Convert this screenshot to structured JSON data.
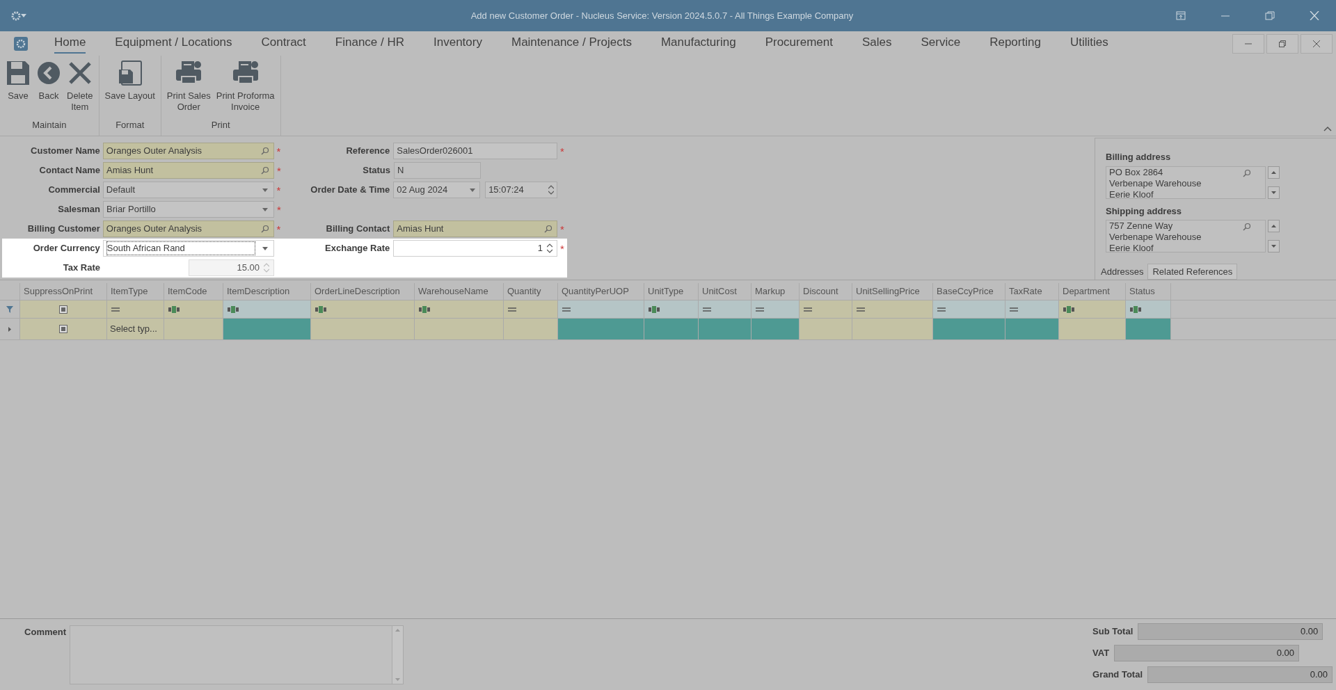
{
  "title_bar": {
    "title": "Add new Customer Order - Nucleus Service: Version 2024.5.0.7 - All Things Example Company"
  },
  "menu_tabs": [
    {
      "label": "Home",
      "selected": true
    },
    {
      "label": "Equipment / Locations",
      "selected": false
    },
    {
      "label": "Contract",
      "selected": false
    },
    {
      "label": "Finance / HR",
      "selected": false
    },
    {
      "label": "Inventory",
      "selected": false
    },
    {
      "label": "Maintenance / Projects",
      "selected": false
    },
    {
      "label": "Manufacturing",
      "selected": false
    },
    {
      "label": "Procurement",
      "selected": false
    },
    {
      "label": "Sales",
      "selected": false
    },
    {
      "label": "Service",
      "selected": false
    },
    {
      "label": "Reporting",
      "selected": false
    },
    {
      "label": "Utilities",
      "selected": false
    }
  ],
  "ribbon_groups": [
    {
      "label": "Maintain",
      "buttons": [
        {
          "label": "Save"
        },
        {
          "label": "Back"
        },
        {
          "label": "Delete\nItem"
        }
      ]
    },
    {
      "label": "Format",
      "buttons": [
        {
          "label": "Save Layout"
        }
      ]
    },
    {
      "label": "Print",
      "buttons": [
        {
          "label": "Print Sales\nOrder"
        },
        {
          "label": "Print Proforma\nInvoice"
        }
      ]
    }
  ],
  "form_rows": [
    {
      "highlighted": false,
      "left": {
        "label": "Customer Name",
        "value": "Oranges Outer Analysis",
        "kind": "lookup",
        "marker": "*"
      },
      "right": {
        "label": "Reference",
        "value": "SalesOrder026001",
        "kind": "text",
        "marker": "*"
      }
    },
    {
      "highlighted": false,
      "left": {
        "label": "Contact Name",
        "value": "Amias Hunt",
        "kind": "lookup",
        "marker": "*"
      },
      "right": {
        "label": "Status",
        "value": "N",
        "kind": "short"
      }
    },
    {
      "highlighted": false,
      "left": {
        "label": "Commercial",
        "value": "Default",
        "kind": "dropdown",
        "marker": "*"
      },
      "right": {
        "label": "Order Date & Time",
        "value": "02 Aug 2024",
        "time": "15:07:24",
        "kind": "datetime"
      }
    },
    {
      "highlighted": false,
      "left": {
        "label": "Salesman",
        "value": "Briar Portillo",
        "kind": "dropdown",
        "marker": "*"
      }
    },
    {
      "highlighted": false,
      "left": {
        "label": "Billing Customer",
        "value": "Oranges Outer Analysis",
        "kind": "lookup",
        "marker": "*"
      },
      "right": {
        "label": "Billing Contact",
        "value": "Amias Hunt",
        "kind": "lookup",
        "marker": "*"
      }
    },
    {
      "highlighted": true,
      "left": {
        "label": "Order Currency",
        "value": "South African Rand",
        "kind": "dropdown"
      },
      "right": {
        "label": "Exchange Rate",
        "value": "1",
        "kind": "spin",
        "marker": "*"
      }
    },
    {
      "highlighted": true,
      "left": {
        "label": "Tax Rate",
        "value": "15.00",
        "kind": "spin_disabled"
      }
    }
  ],
  "addresses": [
    {
      "label": "Billing address",
      "lines": [
        "PO Box 2864",
        "Verbenape Warehouse",
        "Eerie Kloof"
      ]
    },
    {
      "label": "Shipping address",
      "lines": [
        "757 Zenne Way",
        "Verbenape Warehouse",
        "Eerie Kloof"
      ]
    }
  ],
  "address_tabs": [
    {
      "label": "Addresses",
      "selected": true
    },
    {
      "label": "Related References",
      "selected": false
    }
  ],
  "grid": {
    "columns": [
      {
        "name": "SuppressOnPrint",
        "kind": "check",
        "highlighted": false
      },
      {
        "name": "ItemType",
        "kind": "number",
        "highlighted": false
      },
      {
        "name": "ItemCode",
        "kind": "text",
        "highlighted": false
      },
      {
        "name": "ItemDescription",
        "kind": "text",
        "highlighted": true
      },
      {
        "name": "OrderLineDescription",
        "kind": "text",
        "highlighted": false
      },
      {
        "name": "WarehouseName",
        "kind": "text",
        "highlighted": false
      },
      {
        "name": "Quantity",
        "kind": "number",
        "highlighted": false
      },
      {
        "name": "QuantityPerUOP",
        "kind": "number",
        "highlighted": true
      },
      {
        "name": "UnitType",
        "kind": "text",
        "highlighted": true
      },
      {
        "name": "UnitCost",
        "kind": "number",
        "highlighted": true
      },
      {
        "name": "Markup",
        "kind": "number",
        "highlighted": true
      },
      {
        "name": "Discount",
        "kind": "number",
        "highlighted": false
      },
      {
        "name": "UnitSellingPrice",
        "kind": "number",
        "highlighted": false
      },
      {
        "name": "BaseCcyPrice",
        "kind": "number",
        "highlighted": true
      },
      {
        "name": "TaxRate",
        "kind": "number",
        "highlighted": true
      },
      {
        "name": "Department",
        "kind": "text",
        "highlighted": false
      },
      {
        "name": "Status",
        "kind": "text",
        "highlighted": true
      }
    ],
    "new_row": {
      "cells": [
        {
          "kind": "check"
        },
        {
          "kind": "text",
          "value": "Select typ..."
        }
      ]
    }
  },
  "comment": {
    "label": "Comment"
  },
  "totals": [
    {
      "label": "Sub Total",
      "value": "0.00"
    },
    {
      "label": "VAT",
      "value": "0.00"
    },
    {
      "label": "Grand Total",
      "value": "0.00"
    }
  ]
}
